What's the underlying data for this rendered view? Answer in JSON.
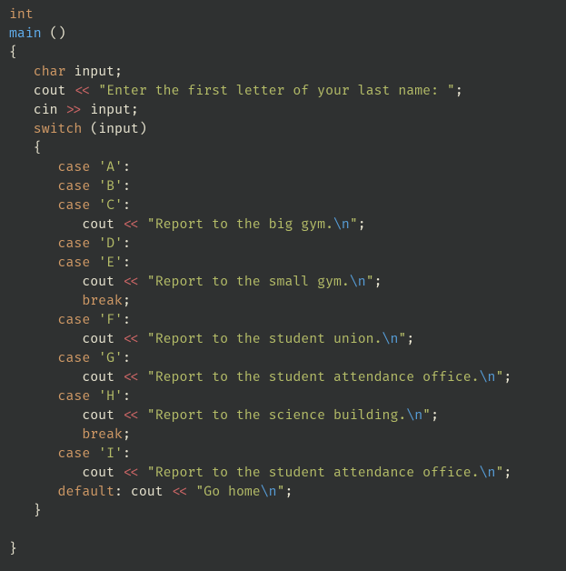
{
  "code": {
    "kw_int": "int",
    "fn_main": "main",
    "kw_char": "char",
    "id_input": "input",
    "id_cout": "cout",
    "id_cin": "cin",
    "op_ins": "<<",
    "op_ext": ">>",
    "str_prompt": "Enter the first letter of your last name: ",
    "kw_switch": "switch",
    "kw_case": "case",
    "kw_break": "break",
    "kw_default": "default",
    "chr_A": "A",
    "chr_B": "B",
    "chr_C": "C",
    "chr_D": "D",
    "chr_E": "E",
    "chr_F": "F",
    "chr_G": "G",
    "chr_H": "H",
    "chr_I": "I",
    "str_big_gym": "Report to the big gym.",
    "str_small_gym": "Report to the small gym.",
    "str_student_union": "Report to the student union.",
    "str_attendance": "Report to the student attendance office.",
    "str_science": "Report to the science building.",
    "str_go_home": "Go home",
    "esc_n": "\\n",
    "lparen": "(",
    "rparen": ")",
    "lbrace": "{",
    "rbrace": "}",
    "semi": ";",
    "colon": ":",
    "sq": "'",
    "dq": "\"",
    "sp": " "
  }
}
